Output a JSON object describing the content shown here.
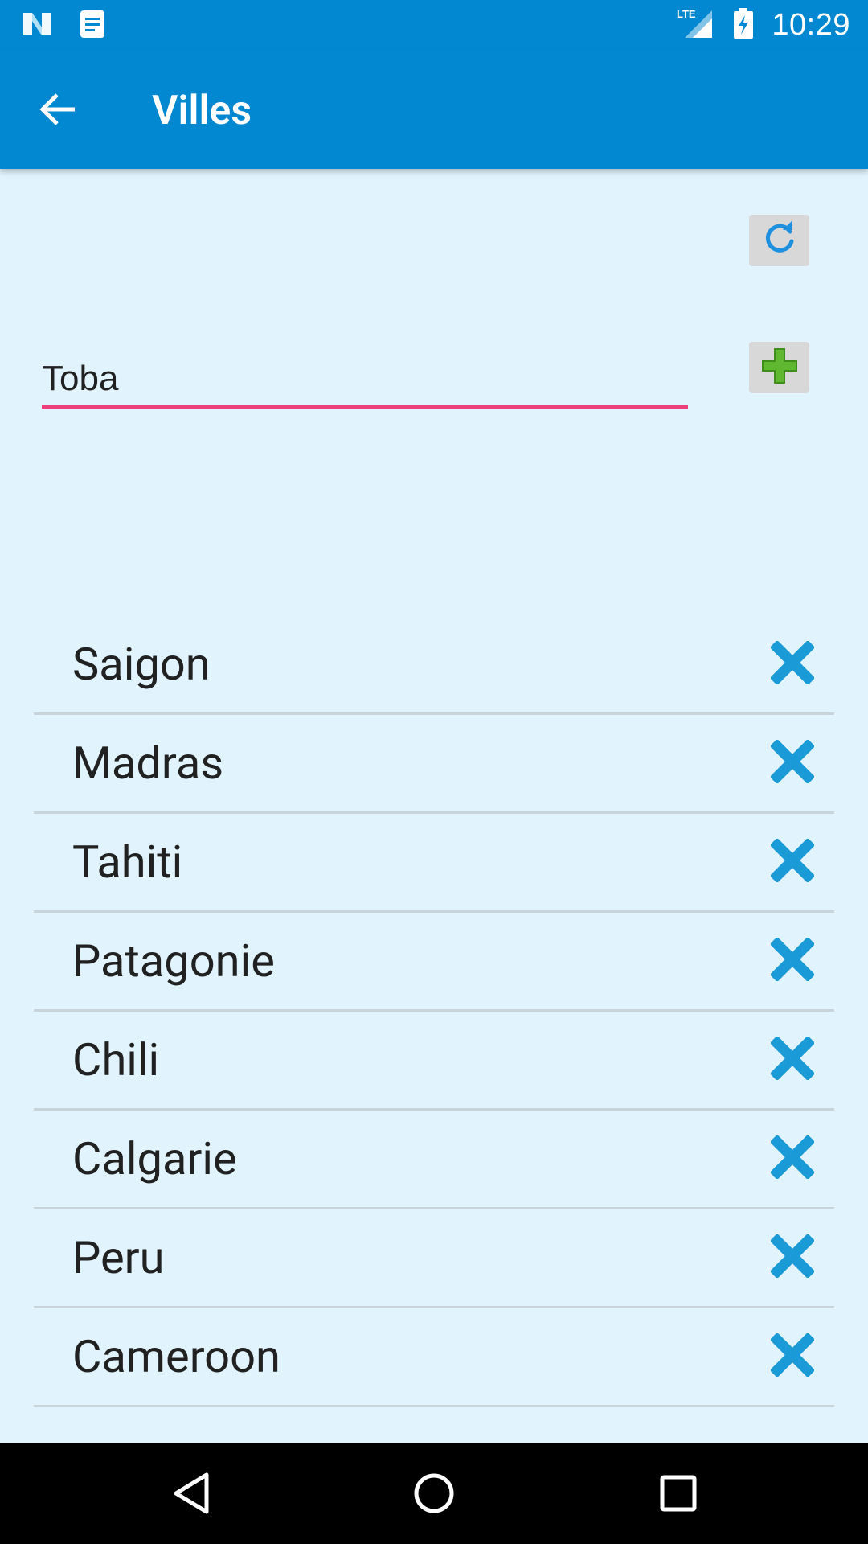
{
  "status_bar": {
    "time": "10:29",
    "network_label": "LTE",
    "left_icons": [
      "n-logo-icon",
      "notes-icon"
    ],
    "right_icons": [
      "lte-signal-icon",
      "battery-charging-icon"
    ]
  },
  "app_bar": {
    "title": "Villes",
    "back_icon": "arrow-back-icon"
  },
  "toolbar": {
    "refresh_icon": "refresh-icon",
    "add_icon": "plus-icon"
  },
  "city_input": {
    "value": "Toba"
  },
  "cities": [
    {
      "name": "Saigon"
    },
    {
      "name": "Madras"
    },
    {
      "name": "Tahiti"
    },
    {
      "name": "Patagonie"
    },
    {
      "name": "Chili"
    },
    {
      "name": "Calgarie"
    },
    {
      "name": "Peru"
    },
    {
      "name": "Cameroon"
    }
  ],
  "colors": {
    "primary": "#0288d1",
    "background": "#e1f3fc",
    "accent_underline": "#ec407a",
    "delete_icon": "#1a9ad6",
    "add_icon": "#5fb82f"
  }
}
